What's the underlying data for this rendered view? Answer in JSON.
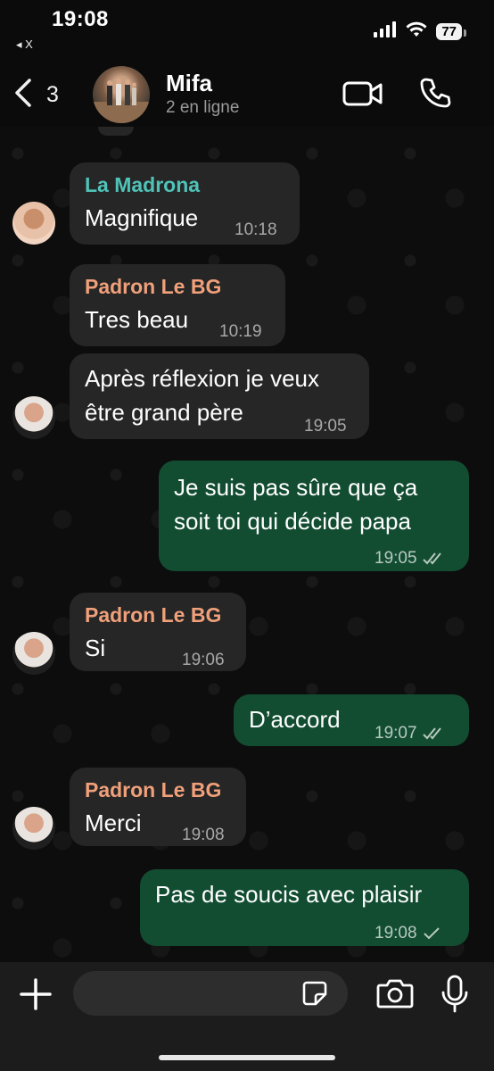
{
  "status_bar": {
    "time": "19:08",
    "back_app": "◂ X",
    "battery": "77"
  },
  "header": {
    "back_count": "3",
    "title": "Mifa",
    "subtitle": "2 en ligne"
  },
  "messages": [
    {
      "direction": "in",
      "sender": "La Madrona",
      "sender_color": "#4fc3b8",
      "text": "Magnifique",
      "time": "10:18"
    },
    {
      "direction": "in",
      "sender": "Padron Le BG",
      "sender_color": "#f0a07a",
      "text": "Tres beau",
      "time": "10:19"
    },
    {
      "direction": "in",
      "sender": "",
      "text_line1": "Après réflexion je veux",
      "text_line2": "être grand père",
      "time": "19:05"
    },
    {
      "direction": "out",
      "text_line1": "Je suis pas sûre que ça",
      "text_line2": "soit toi qui décide papa",
      "time": "19:05",
      "status": "read"
    },
    {
      "direction": "in",
      "sender": "Padron Le BG",
      "sender_color": "#f0a07a",
      "text": "Si",
      "time": "19:06"
    },
    {
      "direction": "out",
      "text": "D’accord",
      "time": "19:07",
      "status": "read"
    },
    {
      "direction": "in",
      "sender": "Padron Le BG",
      "sender_color": "#f0a07a",
      "text": "Merci",
      "time": "19:08"
    },
    {
      "direction": "out",
      "text": "Pas de soucis avec plaisir",
      "time": "19:08",
      "status": "sent"
    }
  ],
  "composer": {
    "placeholder": ""
  },
  "colors": {
    "outgoing_bubble": "#124d32",
    "incoming_bubble": "#262626",
    "tick_color": "#b8c9bf"
  },
  "icons": [
    "chevron-left-icon",
    "video-call-icon",
    "phone-icon",
    "plus-icon",
    "sticker-icon",
    "camera-icon",
    "microphone-icon"
  ]
}
